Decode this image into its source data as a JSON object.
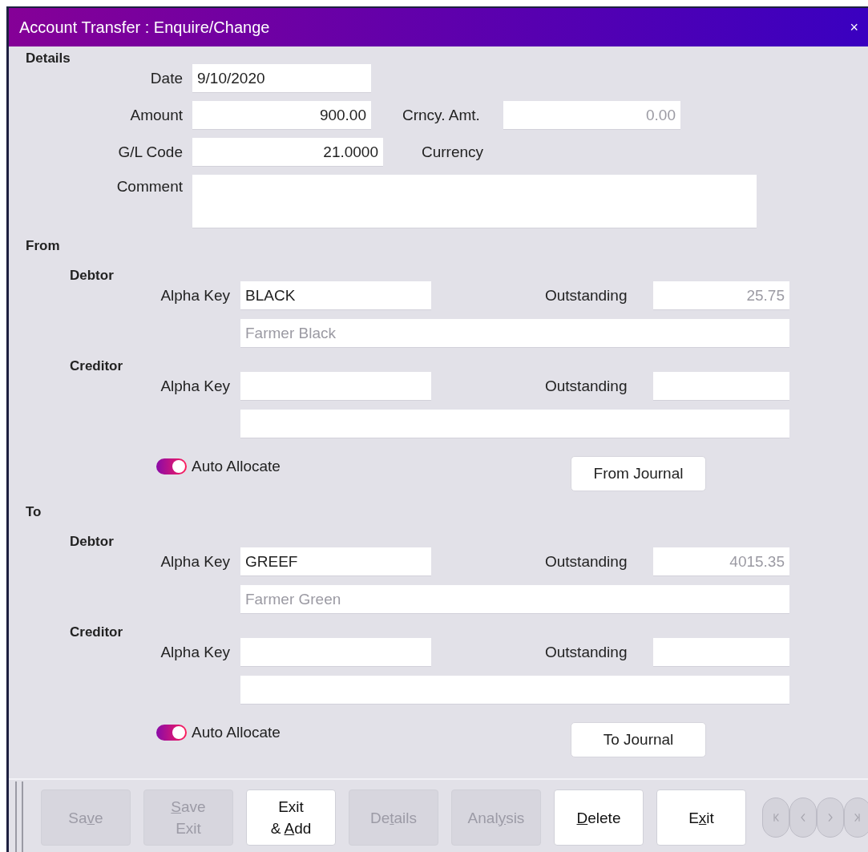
{
  "window": {
    "title": "Account Transfer : Enquire/Change",
    "close": "×"
  },
  "details": {
    "heading": "Details",
    "date": {
      "label": "Date",
      "value": "9/10/2020"
    },
    "amount": {
      "label": "Amount",
      "value": "900.00"
    },
    "crncy_amt": {
      "label": "Crncy. Amt.",
      "value": "0.00"
    },
    "gl_code": {
      "label": "G/L Code",
      "value": "21.0000"
    },
    "currency": {
      "label": "Currency"
    },
    "comment": {
      "label": "Comment"
    }
  },
  "sections": [
    {
      "heading": "From",
      "parties": [
        {
          "heading": "Debtor",
          "alpha_label": "Alpha Key",
          "alpha_value": "BLACK",
          "outstanding_label": "Outstanding",
          "outstanding_value": "25.75",
          "name_value": "Farmer Black"
        },
        {
          "heading": "Creditor",
          "alpha_label": "Alpha Key",
          "outstanding_label": "Outstanding"
        }
      ],
      "auto_allocate": {
        "label": "Auto Allocate",
        "on": true
      },
      "journal_button": "From Journal"
    },
    {
      "heading": "To",
      "parties": [
        {
          "heading": "Debtor",
          "alpha_label": "Alpha Key",
          "alpha_value": "GREEF",
          "outstanding_label": "Outstanding",
          "outstanding_value": "4015.35",
          "name_value": "Farmer Green"
        },
        {
          "heading": "Creditor",
          "alpha_label": "Alpha Key",
          "outstanding_label": "Outstanding"
        }
      ],
      "auto_allocate": {
        "label": "Auto Allocate",
        "on": true
      },
      "journal_button": "To Journal"
    }
  ],
  "toolbar": [
    {
      "lines": [
        [
          {
            "t": "Sa"
          },
          {
            "t": "v",
            "u": true
          },
          {
            "t": "e"
          }
        ]
      ],
      "disabled": true
    },
    {
      "lines": [
        [
          {
            "t": "S",
            "u": true
          },
          {
            "t": "ave"
          }
        ],
        [
          {
            "t": "Exit"
          }
        ]
      ],
      "disabled": true
    },
    {
      "lines": [
        [
          {
            "t": "Exit"
          }
        ],
        [
          {
            "t": "& "
          },
          {
            "t": "A",
            "u": true
          },
          {
            "t": "dd"
          }
        ]
      ],
      "disabled": false
    },
    {
      "lines": [
        [
          {
            "t": "De"
          },
          {
            "t": "t",
            "u": true
          },
          {
            "t": "ails"
          }
        ]
      ],
      "disabled": true
    },
    {
      "lines": [
        [
          {
            "t": "Anal"
          },
          {
            "t": "y",
            "u": true
          },
          {
            "t": "sis"
          }
        ]
      ],
      "disabled": true
    },
    {
      "lines": [
        [
          {
            "t": "D",
            "u": true
          },
          {
            "t": "elete"
          }
        ]
      ],
      "disabled": false
    },
    {
      "lines": [
        [
          {
            "t": "E"
          },
          {
            "t": "x",
            "u": true
          },
          {
            "t": "it"
          }
        ]
      ],
      "disabled": false
    }
  ],
  "nav": [
    {
      "kind": "first",
      "disabled": true
    },
    {
      "kind": "prev",
      "disabled": true
    },
    {
      "kind": "next",
      "disabled": true
    },
    {
      "kind": "last",
      "disabled": true
    }
  ]
}
